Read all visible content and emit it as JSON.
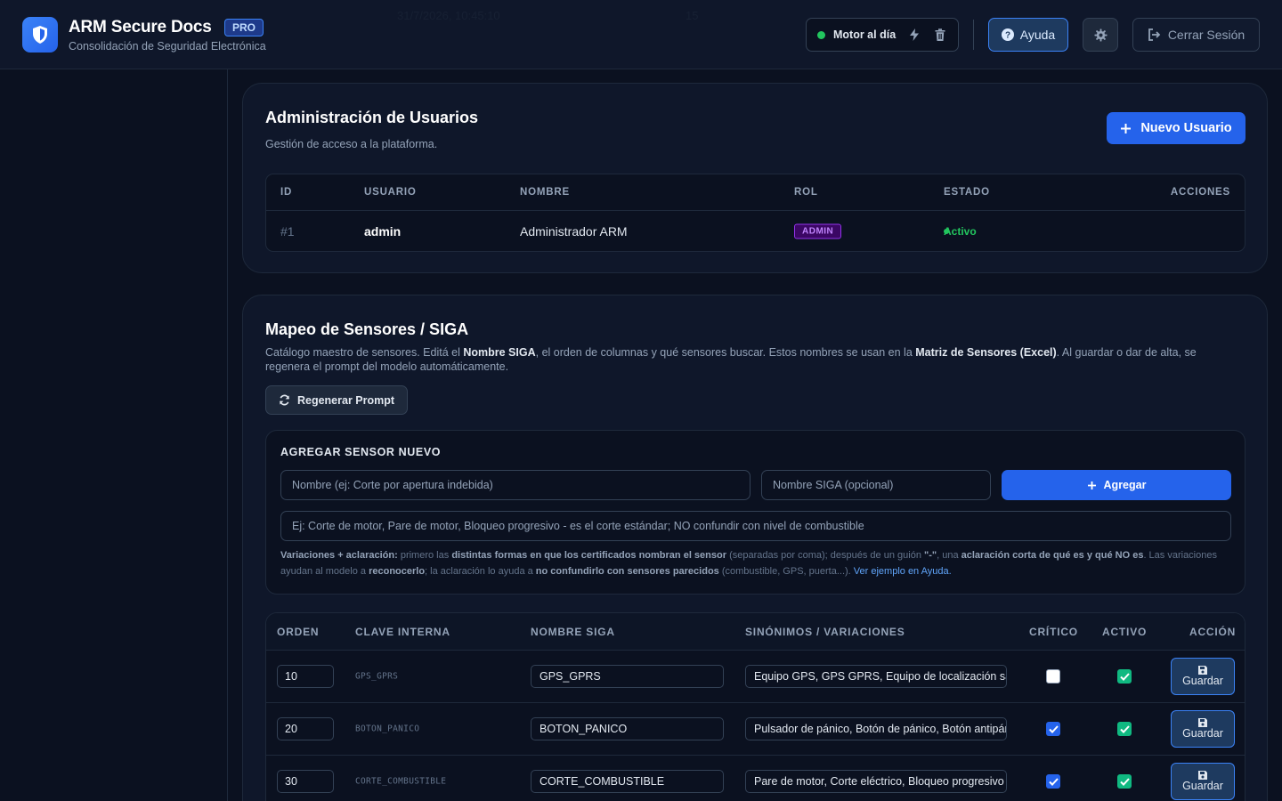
{
  "header": {
    "title": "ARM Secure Docs",
    "badge": "PRO",
    "subtitle": "Consolidación de Seguridad Electrónica",
    "motor_status": "Motor al día",
    "help_label": "Ayuda",
    "logout_label": "Cerrar Sesión",
    "ghost_row": [
      "31/7/2026, 10:45:10",
      "15"
    ]
  },
  "users": {
    "title": "Administración de Usuarios",
    "subtitle": "Gestión de acceso a la plataforma.",
    "new_button": "Nuevo Usuario",
    "columns": [
      "ID",
      "USUARIO",
      "NOMBRE",
      "ROL",
      "ESTADO",
      "ACCIONES"
    ],
    "rows": [
      {
        "id": "#1",
        "user": "admin",
        "name": "Administrador ARM",
        "role": "ADMIN",
        "status": "Activo"
      }
    ]
  },
  "sensors": {
    "title": "Mapeo de Sensores / SIGA",
    "desc_1": "Catálogo maestro de sensores. Editá el ",
    "desc_b1": "Nombre SIGA",
    "desc_2": ", el orden de columnas y qué sensores buscar. Estos nombres se usan en la ",
    "desc_b2": "Matriz de Sensores (Excel)",
    "desc_3": ". Al guardar o dar de alta, se regenera el prompt del modelo automáticamente.",
    "regen_button": "Regenerar Prompt",
    "add": {
      "title": "AGREGAR SENSOR NUEVO",
      "name_placeholder": "Nombre (ej: Corte por apertura indebida)",
      "siga_placeholder": "Nombre SIGA (opcional)",
      "add_button": "Agregar",
      "variations_placeholder": "Ej: Corte de motor, Pare de motor, Bloqueo progresivo - es el corte estándar; NO confundir con nivel de combustible",
      "hint_b1": "Variaciones + aclaración:",
      "hint_1": " primero las ",
      "hint_b2": "distintas formas en que los certificados nombran el sensor",
      "hint_2": " (separadas por coma); después de un guión ",
      "hint_b3": "\"-\"",
      "hint_3": ", una ",
      "hint_b4": "aclaración corta de qué es y qué NO es",
      "hint_4": ". Las variaciones ayudan al modelo a ",
      "hint_b5": "reconocerlo",
      "hint_5": "; la aclaración lo ayuda a ",
      "hint_b6": "no confundirlo con sensores parecidos",
      "hint_6": " (combustible, GPS, puerta...). ",
      "hint_link": "Ver ejemplo en Ayuda."
    },
    "columns": [
      "ORDEN",
      "CLAVE INTERNA",
      "NOMBRE SIGA",
      "SINÓNIMOS / VARIACIONES",
      "CRÍTICO",
      "ACTIVO",
      "ACCIÓN"
    ],
    "save_label": "Guardar",
    "rows": [
      {
        "order": "10",
        "key": "GPS_GPRS",
        "siga": "GPS_GPRS",
        "synonyms": "Equipo GPS, GPS GPRS, Equipo de localización satelital",
        "critical": false,
        "active": true
      },
      {
        "order": "20",
        "key": "BOTON_PANICO",
        "siga": "BOTON_PANICO",
        "synonyms": "Pulsador de pánico, Botón de pánico, Botón antipánico",
        "critical": true,
        "active": true
      },
      {
        "order": "30",
        "key": "CORTE_COMBUSTIBLE",
        "siga": "CORTE_COMBUSTIBLE",
        "synonyms": "Pare de motor, Corte eléctrico, Bloqueo progresivo",
        "critical": true,
        "active": true
      }
    ]
  }
}
